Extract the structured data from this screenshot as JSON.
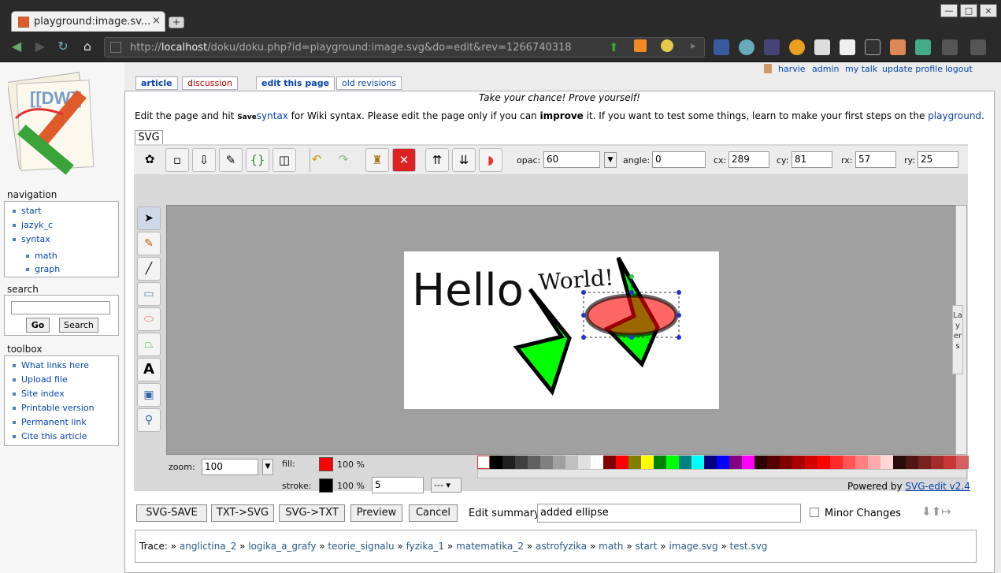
{
  "browser": {
    "tab_title": "playground:image.sv...",
    "url_host": "localhost",
    "url_prefix": "http://",
    "url_rest": "/doku/doku.php?id=playground:image.svg&do=edit&rev=1266740318"
  },
  "user_links": {
    "user": "harvie",
    "admin": "admin",
    "talk": "my talk",
    "profile": "update profile",
    "logout": "logout"
  },
  "page_tabs": {
    "article": "article",
    "discussion": "discussion",
    "edit": "edit this page",
    "revisions": "old revisions"
  },
  "header_msg": "Take your chance! Prove yourself!",
  "intro": {
    "p1": "Edit the page and hit ",
    "save": "Save",
    ". See ": ". See ",
    "syntax": "syntax",
    "p2": " for Wiki syntax. Please edit the page only if you can ",
    "improve": "improve",
    "p3": " it. If you want to test some things, learn to make your first steps on the ",
    "playground": "playground",
    "end": "."
  },
  "svg_label": "SVG",
  "navigation": {
    "title": "navigation",
    "items": [
      "start",
      "jazyk_c",
      "syntax"
    ],
    "sub": [
      "math",
      "graph"
    ]
  },
  "search": {
    "title": "search",
    "go": "Go",
    "search": "Search"
  },
  "toolbox": {
    "title": "toolbox",
    "items": [
      "What links here",
      "Upload file",
      "Site index",
      "Printable version",
      "Permanent link",
      "Cite this article"
    ]
  },
  "props": {
    "opac_label": "opac:",
    "opac": "60",
    "angle_label": "angle:",
    "angle": "0",
    "cx_label": "cx:",
    "cx": "289",
    "cy_label": "cy:",
    "cy": "81",
    "rx_label": "rx:",
    "rx": "57",
    "ry_label": "ry:",
    "ry": "25"
  },
  "canvas": {
    "hello": "Hello",
    "world": "World!",
    "layers": "Layers"
  },
  "bottom": {
    "zoom_label": "zoom:",
    "zoom": "100",
    "fill_label": "fill:",
    "fill_pct": "100 %",
    "stroke_label": "stroke:",
    "stroke_pct": "100 %",
    "stroke_width": "5",
    "dash": "---",
    "powered": "Powered by ",
    "powered_link": "SVG-edit v2.4"
  },
  "colors": {
    "fill": "#ff0000",
    "stroke": "#000000"
  },
  "palette": [
    "#000000",
    "#202020",
    "#404040",
    "#606060",
    "#808080",
    "#a0a0a0",
    "#c0c0c0",
    "#e0e0e0",
    "#ffffff",
    "#800000",
    "#ff0000",
    "#808000",
    "#ffff00",
    "#008000",
    "#00ff00",
    "#008080",
    "#00ffff",
    "#000080",
    "#0000ff",
    "#800080",
    "#ff00ff",
    "#2b0000",
    "#550000",
    "#800000",
    "#aa0000",
    "#d40000",
    "#ff0000",
    "#ff2a2a",
    "#ff5555",
    "#ff8080",
    "#ffaaaa",
    "#ffd5d5",
    "#280b0b",
    "#501616",
    "#782121",
    "#a02c2c",
    "#c83737",
    "#d35f5f"
  ],
  "actions": {
    "svg_save": "SVG-SAVE",
    "txt_svg": "TXT->SVG",
    "svg_txt": "SVG->TXT",
    "preview": "Preview",
    "cancel": "Cancel",
    "summary_label": "Edit summary",
    "summary": "added ellipse",
    "minor": "Minor Changes"
  },
  "trace": {
    "label": "Trace:",
    "items": [
      "anglictina_2",
      "logika_a_grafy",
      "teorie_signalu",
      "fyzika_1",
      "matematika_2",
      "astrofyzika",
      "math",
      "start",
      "image.svg",
      "test.svg"
    ]
  }
}
